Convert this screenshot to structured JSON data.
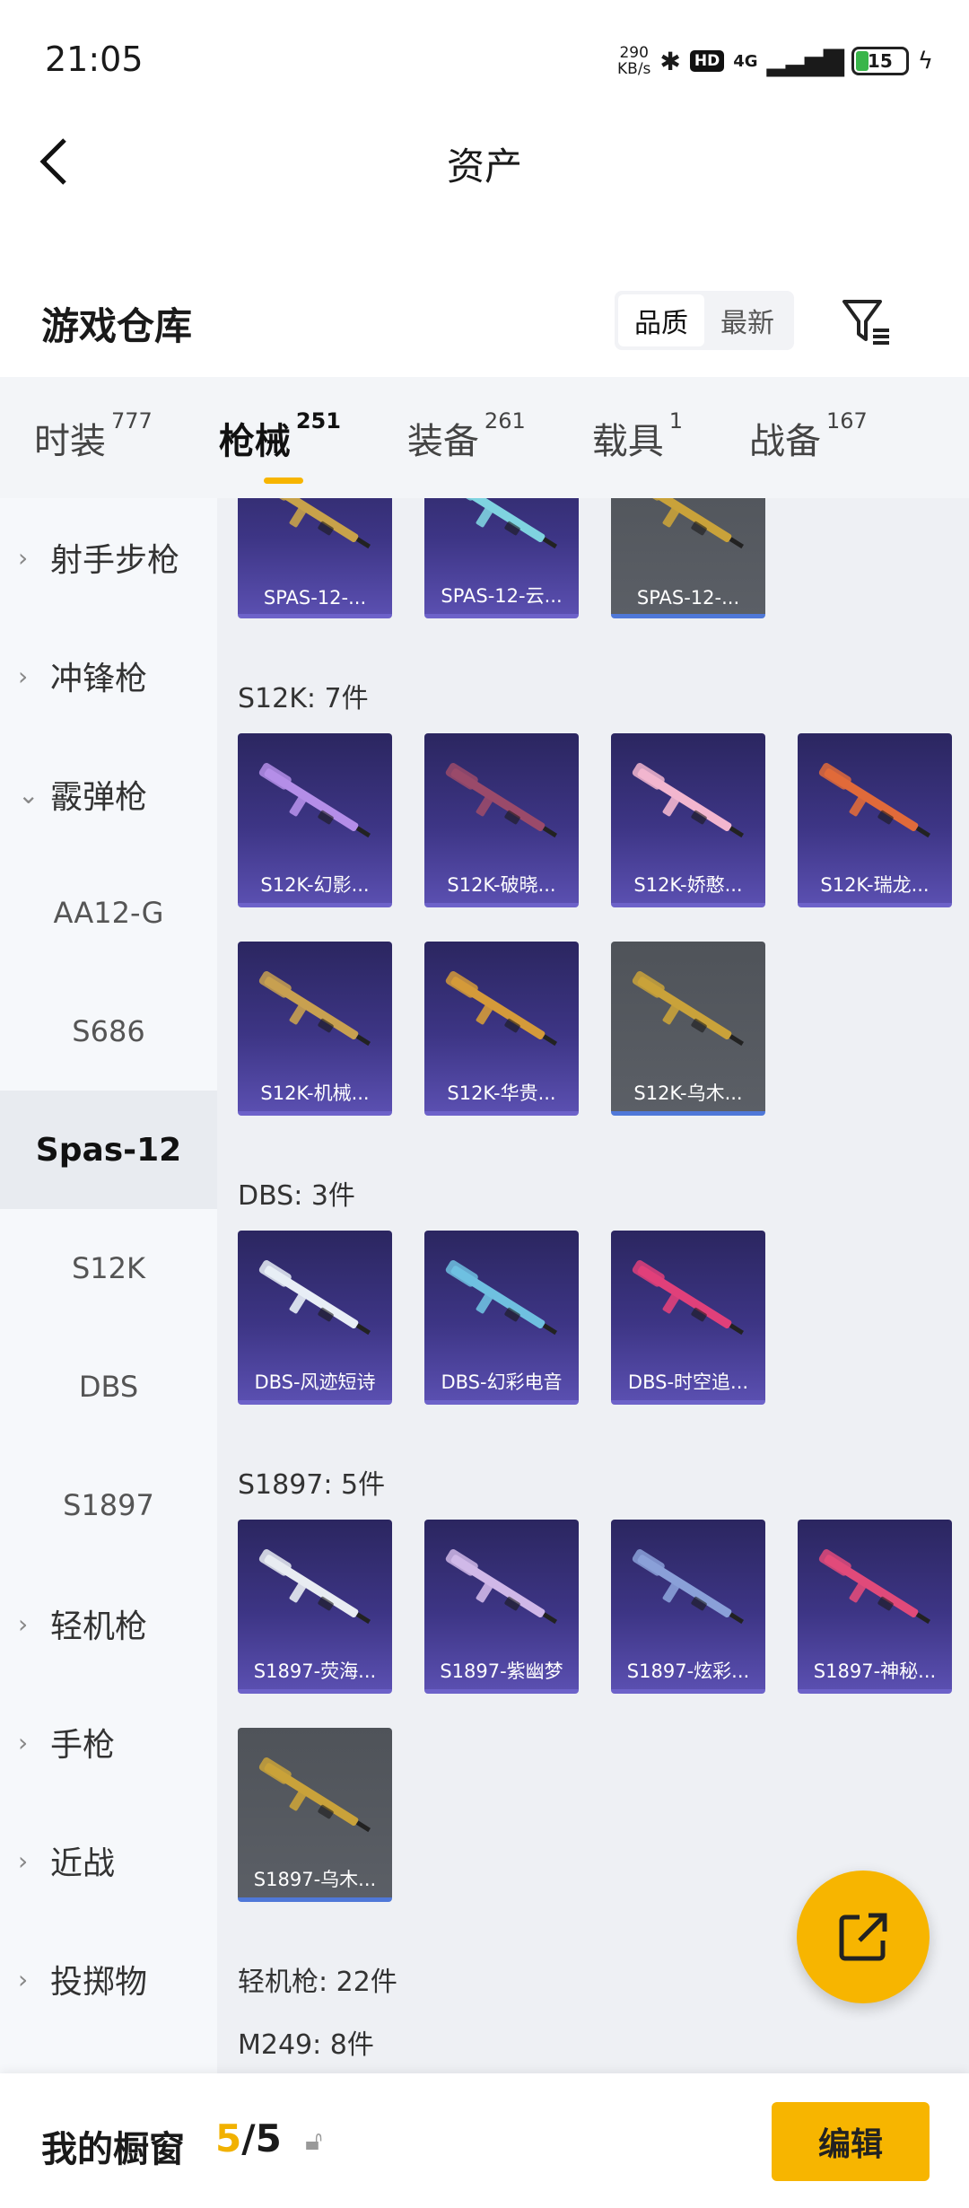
{
  "status": {
    "time": "21:05",
    "net_speed": "290",
    "net_unit": "KB/s",
    "hd": "HD",
    "cell": "4G",
    "battery": "15"
  },
  "header": {
    "title": "资产"
  },
  "repo": {
    "name": "游戏仓库",
    "sort_options": [
      "品质",
      "最新"
    ]
  },
  "tabs": [
    {
      "label": "时装",
      "count": "777"
    },
    {
      "label": "枪械",
      "count": "251"
    },
    {
      "label": "装备",
      "count": "261"
    },
    {
      "label": "载具",
      "count": "1"
    },
    {
      "label": "战备",
      "count": "167"
    }
  ],
  "sidebar": [
    {
      "label": "射手步枪",
      "type": "cat",
      "chev": "›"
    },
    {
      "label": "冲锋枪",
      "type": "cat",
      "chev": "›"
    },
    {
      "label": "霰弹枪",
      "type": "cat",
      "chev": "⌄"
    },
    {
      "label": "AA12-G",
      "type": "sub"
    },
    {
      "label": "S686",
      "type": "sub"
    },
    {
      "label": "Spas-12",
      "type": "sub",
      "active": true
    },
    {
      "label": "S12K",
      "type": "sub"
    },
    {
      "label": "DBS",
      "type": "sub"
    },
    {
      "label": "S1897",
      "type": "sub"
    },
    {
      "label": "轻机枪",
      "type": "cat",
      "chev": "›"
    },
    {
      "label": "手枪",
      "type": "cat",
      "chev": "›"
    },
    {
      "label": "近战",
      "type": "cat",
      "chev": "›"
    },
    {
      "label": "投掷物",
      "type": "cat",
      "chev": "›"
    }
  ],
  "sections": [
    {
      "title": "",
      "items": [
        {
          "label": "SPAS-12-...",
          "grey": false,
          "color": "#c8a24a"
        },
        {
          "label": "SPAS-12-云...",
          "grey": false,
          "color": "#7fd3e0"
        },
        {
          "label": "SPAS-12-...",
          "grey": true,
          "color": "#c9a23a"
        }
      ]
    },
    {
      "title": "S12K: 7件",
      "items": [
        {
          "label": "S12K-幻影...",
          "grey": false,
          "color": "#b48ee8"
        },
        {
          "label": "S12K-破晓...",
          "grey": false,
          "color": "#9a4a6a"
        },
        {
          "label": "S12K-娇憨...",
          "grey": false,
          "color": "#f2b6cf"
        },
        {
          "label": "S12K-瑞龙...",
          "grey": false,
          "color": "#e06a3a"
        },
        {
          "label": "S12K-机械...",
          "grey": false,
          "color": "#c8a050"
        },
        {
          "label": "S12K-华贵...",
          "grey": false,
          "color": "#d49a3a"
        },
        {
          "label": "S12K-乌木...",
          "grey": true,
          "color": "#c9a23a"
        }
      ]
    },
    {
      "title": "DBS: 3件",
      "items": [
        {
          "label": "DBS-风迹短诗",
          "grey": false,
          "color": "#e8eef6"
        },
        {
          "label": "DBS-幻彩电音",
          "grey": false,
          "color": "#6fc0e0"
        },
        {
          "label": "DBS-时空追...",
          "grey": false,
          "color": "#e0407a"
        }
      ]
    },
    {
      "title": "S1897: 5件",
      "items": [
        {
          "label": "S1897-荧海...",
          "grey": false,
          "color": "#e8ecf2"
        },
        {
          "label": "S1897-紫幽梦",
          "grey": false,
          "color": "#d0b8e8"
        },
        {
          "label": "S1897-炫彩...",
          "grey": false,
          "color": "#8aa0d8"
        },
        {
          "label": "S1897-神秘...",
          "grey": false,
          "color": "#e04a7a"
        },
        {
          "label": "S1897-乌木...",
          "grey": true,
          "color": "#c9a23a"
        }
      ]
    },
    {
      "title": "轻机枪: 22件",
      "items": []
    },
    {
      "title": "M249: 8件",
      "items": [
        {
          "label": "",
          "grey": false,
          "color": "#c8d8f0"
        },
        {
          "label": "",
          "grey": false,
          "color": "#c04060"
        },
        {
          "label": "",
          "grey": false,
          "color": "#8a8a8a"
        },
        {
          "label": "",
          "grey": false,
          "color": "#c05040"
        }
      ]
    }
  ],
  "bottom": {
    "label": "我的橱窗",
    "count_current": "5",
    "count_sep": "/",
    "count_total": "5",
    "edit_label": "编辑"
  }
}
